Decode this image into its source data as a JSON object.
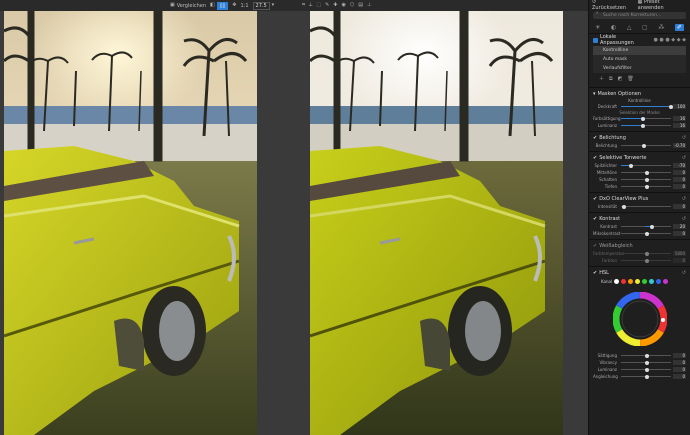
{
  "toolbar": {
    "compare_label": "Vergleichen",
    "zoom_label": "1:1",
    "zoom_value": "27.5"
  },
  "panel": {
    "back_label": "Zurücksetzen",
    "preset_label": "Preset anwenden",
    "search_placeholder": "Suche nach Korrekturen...",
    "local_adjustments": {
      "title": "Lokale Anpassungen",
      "items": [
        "Kontrollline",
        "Auto mask",
        "Verlaufsfilter"
      ]
    },
    "mask_options": {
      "title": "Masken Optionen",
      "sub": "Kontrollinie",
      "sliders": [
        {
          "label": "Deckkraft",
          "value": "100"
        },
        {
          "label": "Farbsättigung",
          "value": "16"
        },
        {
          "label": "Luminanz",
          "value": "16"
        }
      ],
      "selection_label": "Selektion der Maske"
    },
    "exposure": {
      "title": "Belichtung",
      "slider_label": "Belichtung",
      "value": "-0.70"
    },
    "tones": {
      "title": "Selektive Tonwerte",
      "sliders": [
        {
          "label": "Spitzlichter",
          "value": "-70"
        },
        {
          "label": "Mitteltöne",
          "value": "0"
        },
        {
          "label": "Schatten",
          "value": "0"
        },
        {
          "label": "Tiefen",
          "value": "0"
        }
      ]
    },
    "clearview": {
      "title": "DxO ClearView Plus",
      "slider_label": "Intensität",
      "value": "0"
    },
    "contrast": {
      "title": "Kontrast",
      "sliders": [
        {
          "label": "Kontrast",
          "value": "20"
        },
        {
          "label": "Mikrokontrast",
          "value": "0"
        }
      ]
    },
    "white_balance": {
      "title": "Weißabgleich",
      "sliders": [
        {
          "label": "Farbtemperatur",
          "value": "5800"
        },
        {
          "label": "Farbton",
          "value": "0"
        }
      ]
    },
    "hsl": {
      "title": "HSL",
      "channel_label": "Kanal",
      "sliders": [
        {
          "label": "Sättigung",
          "value": "0"
        },
        {
          "label": "Vibrancy",
          "value": "0"
        },
        {
          "label": "Luminanz",
          "value": "0"
        },
        {
          "label": "Angleichung",
          "value": "0"
        }
      ]
    }
  }
}
